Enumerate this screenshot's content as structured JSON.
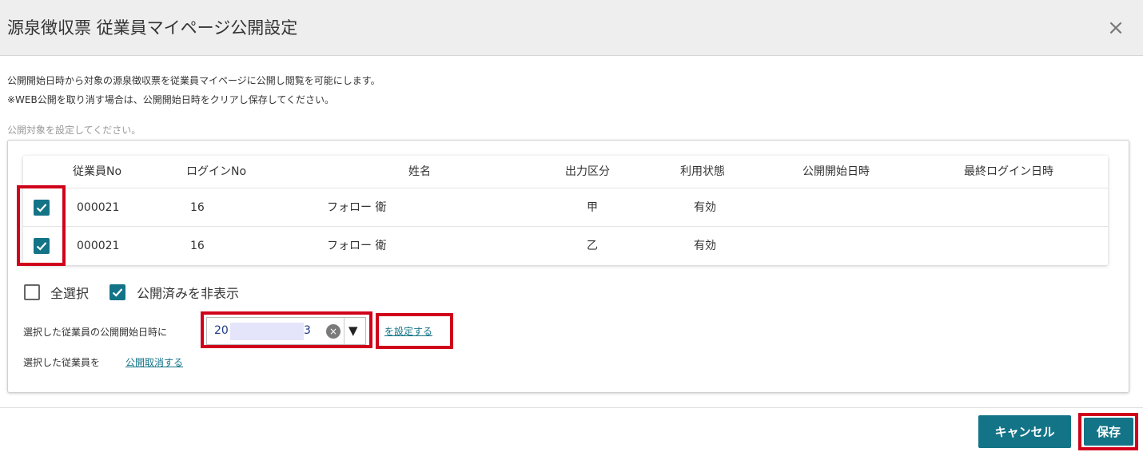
{
  "dialog": {
    "title": "源泉徴収票 従業員マイページ公開設定",
    "close_symbol": "×"
  },
  "description": {
    "line1": "公開開始日時から対象の源泉徴収票を従業員マイページに公開し閲覧を可能にします。",
    "line2": "※WEB公開を取り消す場合は、公開開始日時をクリアし保存してください。"
  },
  "section_label": "公開対象を設定してください。",
  "table": {
    "headers": [
      "従業員No",
      "ログインNo",
      "姓名",
      "出力区分",
      "利用状態",
      "公開開始日時",
      "最終ログイン日時"
    ],
    "rows": [
      {
        "checked": true,
        "employee_no": "000021",
        "login_no": "16",
        "name": "フォロー 衛",
        "output_type": "甲",
        "status": "有効",
        "publish_start": "",
        "last_login": ""
      },
      {
        "checked": true,
        "employee_no": "000021",
        "login_no": "16",
        "name": "フォロー 衛",
        "output_type": "乙",
        "status": "有効",
        "publish_start": "",
        "last_login": ""
      }
    ]
  },
  "options": {
    "select_all_label": "全選択",
    "select_all_checked": false,
    "hide_published_label": "公開済みを非表示",
    "hide_published_checked": true
  },
  "publish_date": {
    "label": "選択した従業員の公開開始日時に",
    "value_prefix": "20",
    "value_suffix": "3",
    "clear_symbol": "×",
    "dropdown_symbol": "▼",
    "set_link": "を設定する"
  },
  "unpublish": {
    "label": "選択した従業員を",
    "link": "公開取消する"
  },
  "buttons": {
    "cancel": "キャンセル",
    "save": "保存"
  },
  "colors": {
    "accent": "#147487",
    "highlight": "#d0021b",
    "header_bg": "#eeeeee"
  }
}
